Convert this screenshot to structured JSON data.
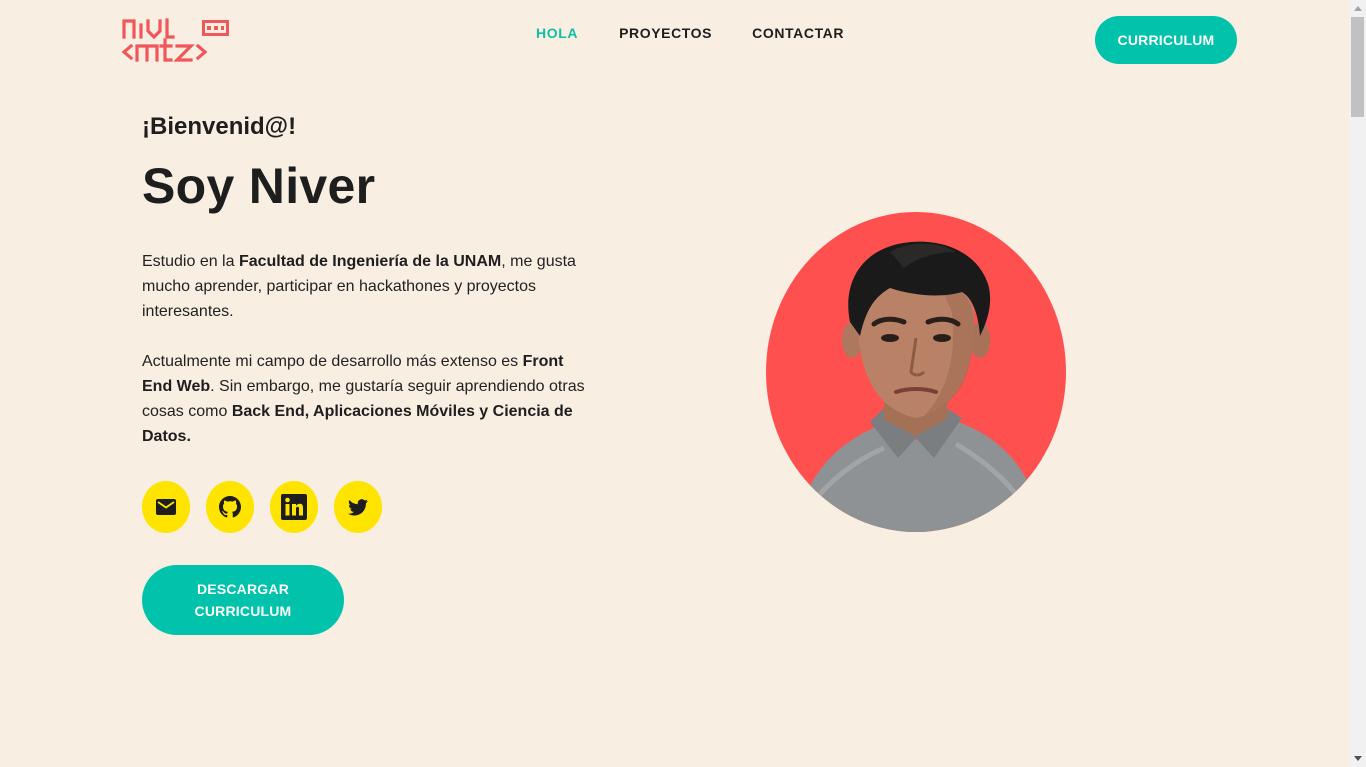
{
  "header": {
    "logo_alt": "nivl mtz",
    "nav": [
      {
        "label": "HOLA",
        "active": true
      },
      {
        "label": "PROYECTOS",
        "active": false
      },
      {
        "label": "CONTACTAR",
        "active": false
      }
    ],
    "cv_button": "CURRICULUM"
  },
  "hero": {
    "greeting": "¡Bienvenid@!",
    "name": "Soy Niver",
    "p1": {
      "t1": "Estudio en la ",
      "b1": "Facultad de Ingeniería de la UNAM",
      "t2": ", me gusta mucho aprender, participar en hackathones y proyectos interesantes."
    },
    "p2": {
      "t1": "Actualmente mi campo de desarrollo más extenso es ",
      "b1": "Front End Web",
      "t2": ". Sin embargo, me gustaría seguir aprendiendo otras cosas como ",
      "b2": "Back End, Aplicaciones Móviles y Ciencia de Datos."
    },
    "socials": [
      {
        "icon": "mail-icon"
      },
      {
        "icon": "github-icon"
      },
      {
        "icon": "linkedin-icon"
      },
      {
        "icon": "twitter-icon"
      }
    ],
    "download_button": "DESCARGAR CURRICULUM"
  },
  "colors": {
    "background": "#f8eee2",
    "accent": "#01c2ab",
    "nav_active": "#12bfa6",
    "social_bg": "#ffe400",
    "avatar_bg": "#ff5050",
    "logo": "#f0565a"
  }
}
